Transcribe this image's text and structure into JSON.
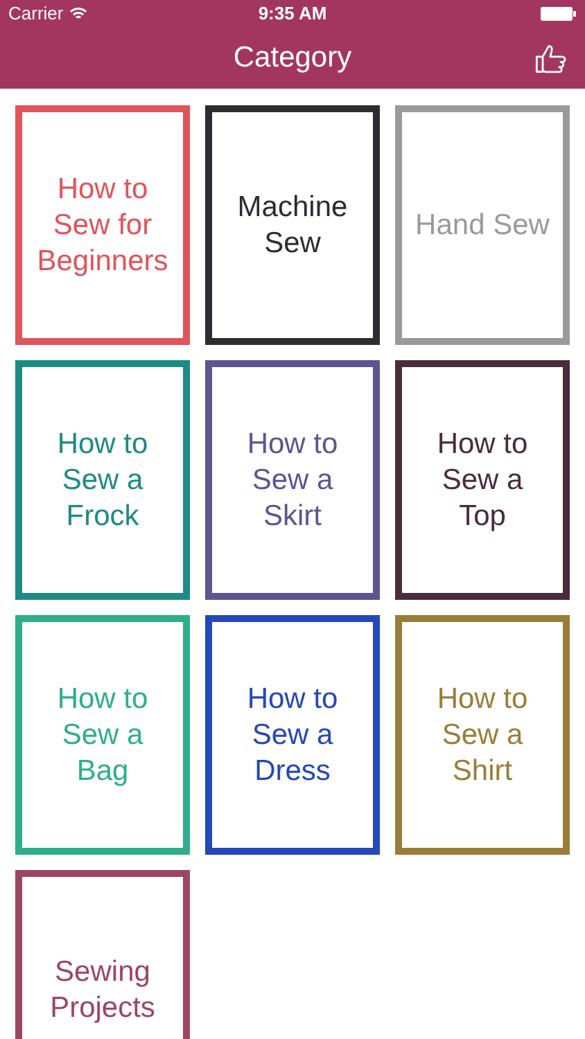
{
  "status_bar": {
    "carrier": "Carrier",
    "time": "9:35 AM"
  },
  "nav_bar": {
    "title": "Category"
  },
  "categories": [
    {
      "lines": [
        "How to",
        "Sew for",
        "Beginners"
      ],
      "color": "#e0545a"
    },
    {
      "lines": [
        "Machine",
        "Sew"
      ],
      "color": "#2b2d33"
    },
    {
      "lines": [
        "Hand Sew"
      ],
      "color": "#9a9a9a"
    },
    {
      "lines": [
        "How to",
        "Sew a",
        "Frock"
      ],
      "color": "#1e8a86"
    },
    {
      "lines": [
        "How to",
        "Sew a",
        "Skirt"
      ],
      "color": "#5e5491"
    },
    {
      "lines": [
        "How to",
        "Sew a",
        "Top"
      ],
      "color": "#4a2d3c"
    },
    {
      "lines": [
        "How to",
        "Sew a",
        "Bag"
      ],
      "color": "#2fae8a"
    },
    {
      "lines": [
        "How to",
        "Sew a",
        "Dress"
      ],
      "color": "#2448b8"
    },
    {
      "lines": [
        "How to",
        "Sew a",
        "Shirt"
      ],
      "color": "#9a7d38"
    },
    {
      "lines": [
        "Sewing",
        "Projects"
      ],
      "color": "#9c4663"
    }
  ]
}
